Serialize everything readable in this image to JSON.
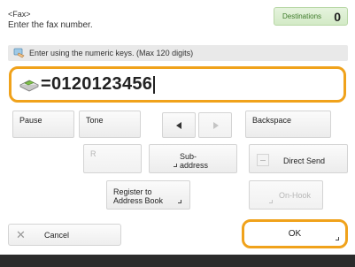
{
  "header": {
    "title": "<Fax>",
    "subtitle": "Enter the fax number.",
    "destinations_label": "Destinations",
    "destinations_count": "0"
  },
  "instruction": {
    "text": "Enter using the numeric keys. (Max 120 digits)",
    "icon": "keypad-hand-icon"
  },
  "number_field": {
    "icon": "fax-machine-icon",
    "prefix": "=",
    "value": "0120123456"
  },
  "keys": {
    "pause": "Pause",
    "tone": "Tone",
    "backspace": "Backspace",
    "r": "R",
    "subaddress_line1": "Sub-",
    "subaddress_line2": "address",
    "direct_send": "Direct Send",
    "register_line1": "Register to",
    "register_line2": "Address Book",
    "on_hook": "On-Hook"
  },
  "footer": {
    "cancel": "Cancel",
    "ok": "OK"
  },
  "colors": {
    "accent": "#f0a21b",
    "destinations_bg": "#d9eecd",
    "destinations_text": "#3d7a2a",
    "disabled_text": "#b6b6b6"
  }
}
